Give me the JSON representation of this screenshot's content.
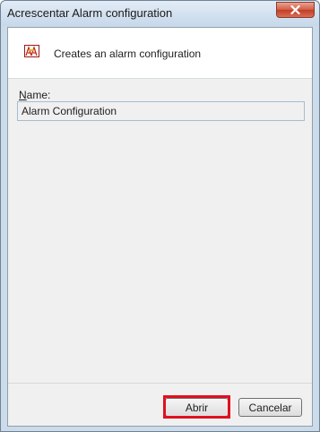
{
  "window": {
    "title": "Acrescentar Alarm configuration"
  },
  "header": {
    "icon": "alarm-icon",
    "description": "Creates an alarm configuration"
  },
  "form": {
    "name_label_accel": "N",
    "name_label_rest": "ame:",
    "name_value": "Alarm Configuration"
  },
  "buttons": {
    "open_label": "Abrir",
    "cancel_label": "Cancelar"
  },
  "colors": {
    "highlight": "#e0101f",
    "close_button": "#c23d25"
  }
}
